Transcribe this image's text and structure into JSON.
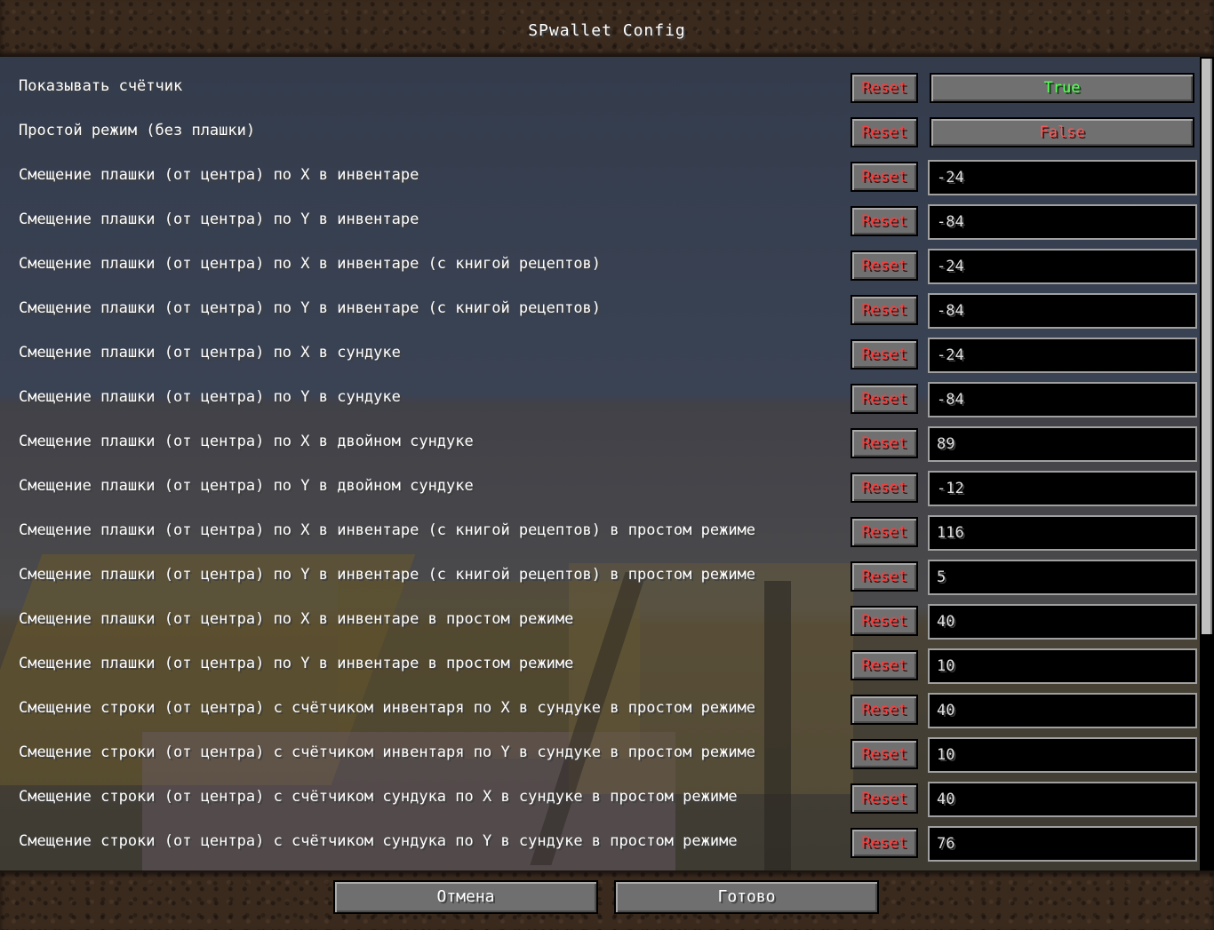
{
  "window": {
    "title": "SPwallet Config"
  },
  "options": [
    {
      "label": "Показывать счётчик",
      "reset": "Reset",
      "type": "toggle",
      "value": "True"
    },
    {
      "label": "Простой режим (без плашки)",
      "reset": "Reset",
      "type": "toggle",
      "value": "False"
    },
    {
      "label": "Смещение плашки (от центра) по X в инвентаре",
      "reset": "Reset",
      "type": "field",
      "value": "-24"
    },
    {
      "label": "Смещение плашки (от центра) по Y в инвентаре",
      "reset": "Reset",
      "type": "field",
      "value": "-84"
    },
    {
      "label": "Смещение плашки (от центра) по X в инвентаре (с книгой рецептов)",
      "reset": "Reset",
      "type": "field",
      "value": "-24"
    },
    {
      "label": "Смещение плашки (от центра) по Y в инвентаре (с книгой рецептов)",
      "reset": "Reset",
      "type": "field",
      "value": "-84"
    },
    {
      "label": "Смещение плашки (от центра) по X в сундуке",
      "reset": "Reset",
      "type": "field",
      "value": "-24"
    },
    {
      "label": "Смещение плашки (от центра) по Y в сундуке",
      "reset": "Reset",
      "type": "field",
      "value": "-84"
    },
    {
      "label": "Смещение плашки (от центра) по X в двойном сундуке",
      "reset": "Reset",
      "type": "field",
      "value": "89"
    },
    {
      "label": "Смещение плашки (от центра) по Y в двойном сундуке",
      "reset": "Reset",
      "type": "field",
      "value": "-12"
    },
    {
      "label": "Смещение плашки (от центра) по X в инвентаре (с книгой рецептов) в простом режиме",
      "reset": "Reset",
      "type": "field",
      "value": "116"
    },
    {
      "label": "Смещение плашки (от центра) по Y в инвентаре (с книгой рецептов) в простом режиме",
      "reset": "Reset",
      "type": "field",
      "value": "5"
    },
    {
      "label": "Смещение плашки (от центра) по X в инвентаре в простом режиме",
      "reset": "Reset",
      "type": "field",
      "value": "40"
    },
    {
      "label": "Смещение плашки (от центра) по Y в инвентаре в простом режиме",
      "reset": "Reset",
      "type": "field",
      "value": "10"
    },
    {
      "label": "Смещение строки (от центра) с счётчиком инвентаря по X в сундуке в простом режиме",
      "reset": "Reset",
      "type": "field",
      "value": "40"
    },
    {
      "label": "Смещение строки (от центра) с счётчиком инвентаря по Y в сундуке в простом режиме",
      "reset": "Reset",
      "type": "field",
      "value": "10"
    },
    {
      "label": "Смещение строки (от центра) с счётчиком сундука по X в сундуке в простом режиме",
      "reset": "Reset",
      "type": "field",
      "value": "40"
    },
    {
      "label": "Смещение строки (от центра) с счётчиком сундука по Y в сундуке в простом режиме",
      "reset": "Reset",
      "type": "field",
      "value": "76"
    }
  ],
  "footer": {
    "cancel_label": "Отмена",
    "done_label": "Готово"
  },
  "colors": {
    "toggle_true": "#55ff55",
    "toggle_false": "#ff5555",
    "reset_text": "#ff3b3b"
  }
}
